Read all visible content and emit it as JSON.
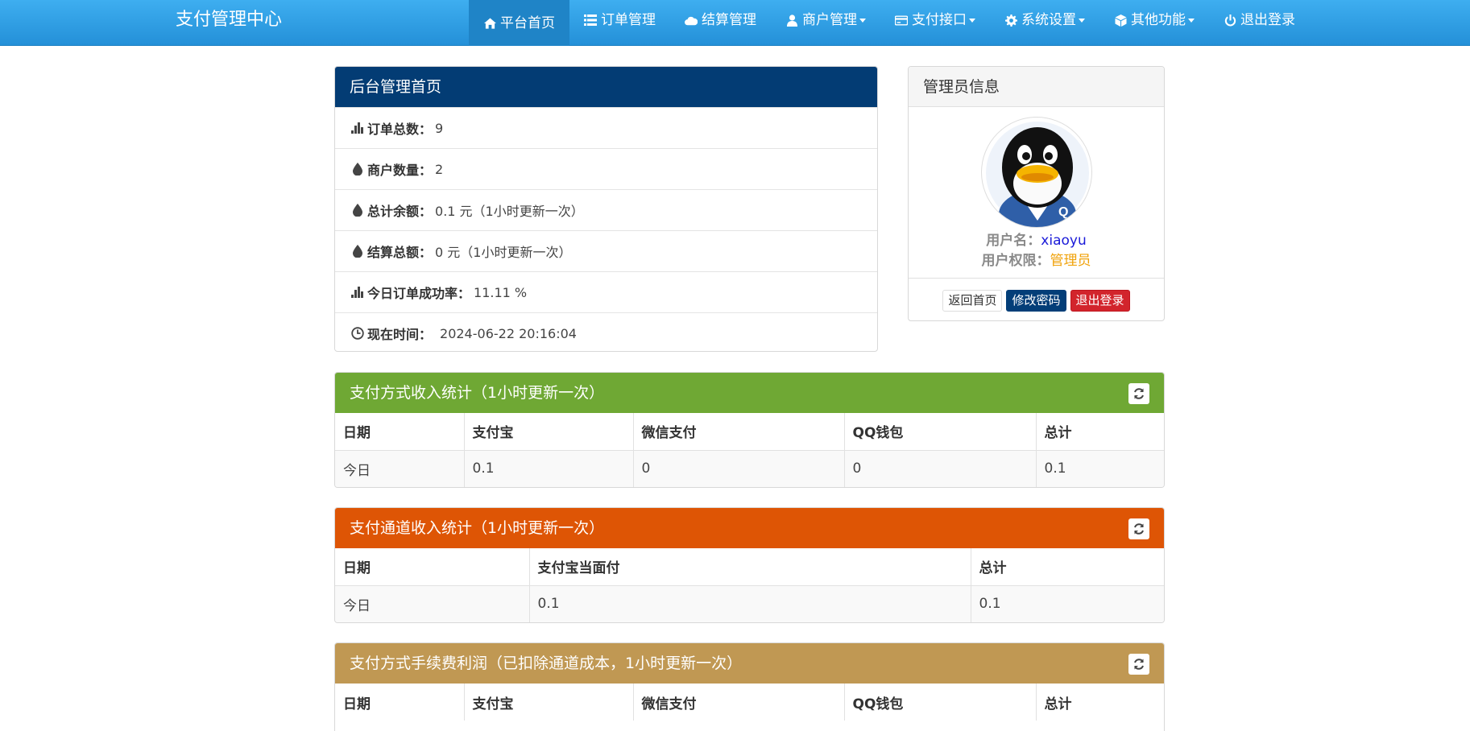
{
  "brand": "支付管理中心",
  "nav": [
    {
      "label": "平台首页",
      "icon": "home-icon",
      "active": true,
      "dropdown": false
    },
    {
      "label": "订单管理",
      "icon": "list-icon",
      "active": false,
      "dropdown": false
    },
    {
      "label": "结算管理",
      "icon": "cloud-icon",
      "active": false,
      "dropdown": false
    },
    {
      "label": "商户管理",
      "icon": "user-icon",
      "active": false,
      "dropdown": true
    },
    {
      "label": "支付接口",
      "icon": "credit-card-icon",
      "active": false,
      "dropdown": true
    },
    {
      "label": "系统设置",
      "icon": "gear-icon",
      "active": false,
      "dropdown": true
    },
    {
      "label": "其他功能",
      "icon": "box-icon",
      "active": false,
      "dropdown": true
    },
    {
      "label": "退出登录",
      "icon": "power-icon",
      "active": false,
      "dropdown": false
    }
  ],
  "dashboard": {
    "title": "后台管理首页",
    "header_color": "#033c74",
    "items": [
      {
        "icon": "stats-icon",
        "label": "订单总数：",
        "value": "9"
      },
      {
        "icon": "tint-icon",
        "label": "商户数量：",
        "value": "2"
      },
      {
        "icon": "tint-icon",
        "label": "总计余额：",
        "value": "0.1 元（1小时更新一次）"
      },
      {
        "icon": "tint-icon",
        "label": "结算总额：",
        "value": "0 元（1小时更新一次）"
      },
      {
        "icon": "stats-icon",
        "label": "今日订单成功率：",
        "value": "11.11 %"
      },
      {
        "icon": "clock-icon",
        "label": "现在时间：",
        "value": "2024-06-22 20:16:04"
      }
    ]
  },
  "admin": {
    "title": "管理员信息",
    "username_label": "用户名：",
    "username": "xiaoyu",
    "role_label": "用户权限：",
    "role": "管理员",
    "buttons": {
      "home": "返回首页",
      "password": "修改密码",
      "logout": "退出登录"
    }
  },
  "pay_method_stats": {
    "title": "支付方式收入统计（1小时更新一次）",
    "color": "#6fa834",
    "columns": [
      "日期",
      "支付宝",
      "微信支付",
      "QQ钱包",
      "总计"
    ],
    "rows": [
      [
        "今日",
        "0.1",
        "0",
        "0",
        "0.1"
      ]
    ]
  },
  "channel_stats": {
    "title": "支付通道收入统计（1小时更新一次）",
    "color": "#de5505",
    "columns": [
      "日期",
      "支付宝当面付",
      "总计"
    ],
    "rows": [
      [
        "今日",
        "0.1",
        "0.1"
      ]
    ]
  },
  "fee_stats": {
    "title": "支付方式手续费利润（已扣除通道成本，1小时更新一次）",
    "color": "#c09853",
    "columns": [
      "日期",
      "支付宝",
      "微信支付",
      "QQ钱包",
      "总计"
    ]
  }
}
